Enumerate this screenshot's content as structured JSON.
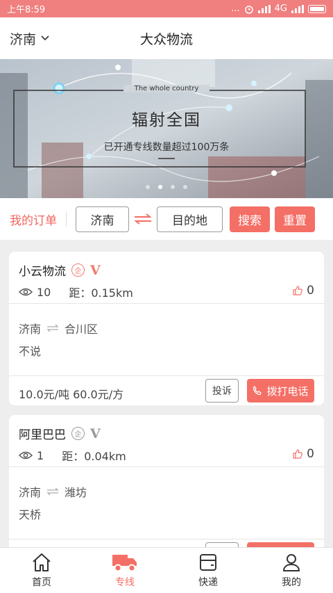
{
  "status_bar": {
    "time": "上午8:59",
    "dots": "...",
    "network": "4G"
  },
  "header": {
    "city": "济南",
    "title": "大众物流"
  },
  "banner": {
    "subtitle_en": "The whole country",
    "headline": "辐射全国",
    "tagline": "已开通专线数量超过100万条",
    "page_count": 4,
    "active_page": 1
  },
  "controls": {
    "my_orders": "我的订单",
    "origin": "济南",
    "destination": "目的地",
    "search": "搜索",
    "reset": "重置"
  },
  "cards": [
    {
      "name": "小云物流",
      "qi": "企",
      "verified": "V",
      "views": "10",
      "distance": "距：0.15km",
      "likes": "0",
      "from": "济南",
      "to": "合川区",
      "note": "不说",
      "price": "10.0元/吨 60.0元/方",
      "complain": "投诉",
      "call": "拨打电话"
    },
    {
      "name": "阿里巴巴",
      "qi": "企",
      "verified": "V",
      "views": "1",
      "distance": "距：0.04km",
      "likes": "0",
      "from": "济南",
      "to": "潍坊",
      "note": "天桥",
      "price": "",
      "complain": "",
      "call": ""
    }
  ],
  "tabs": [
    {
      "label": "首页"
    },
    {
      "label": "专线"
    },
    {
      "label": "快递"
    },
    {
      "label": "我的"
    }
  ],
  "colors": {
    "accent": "#f46f66",
    "status_bar": "#f07f7f"
  }
}
